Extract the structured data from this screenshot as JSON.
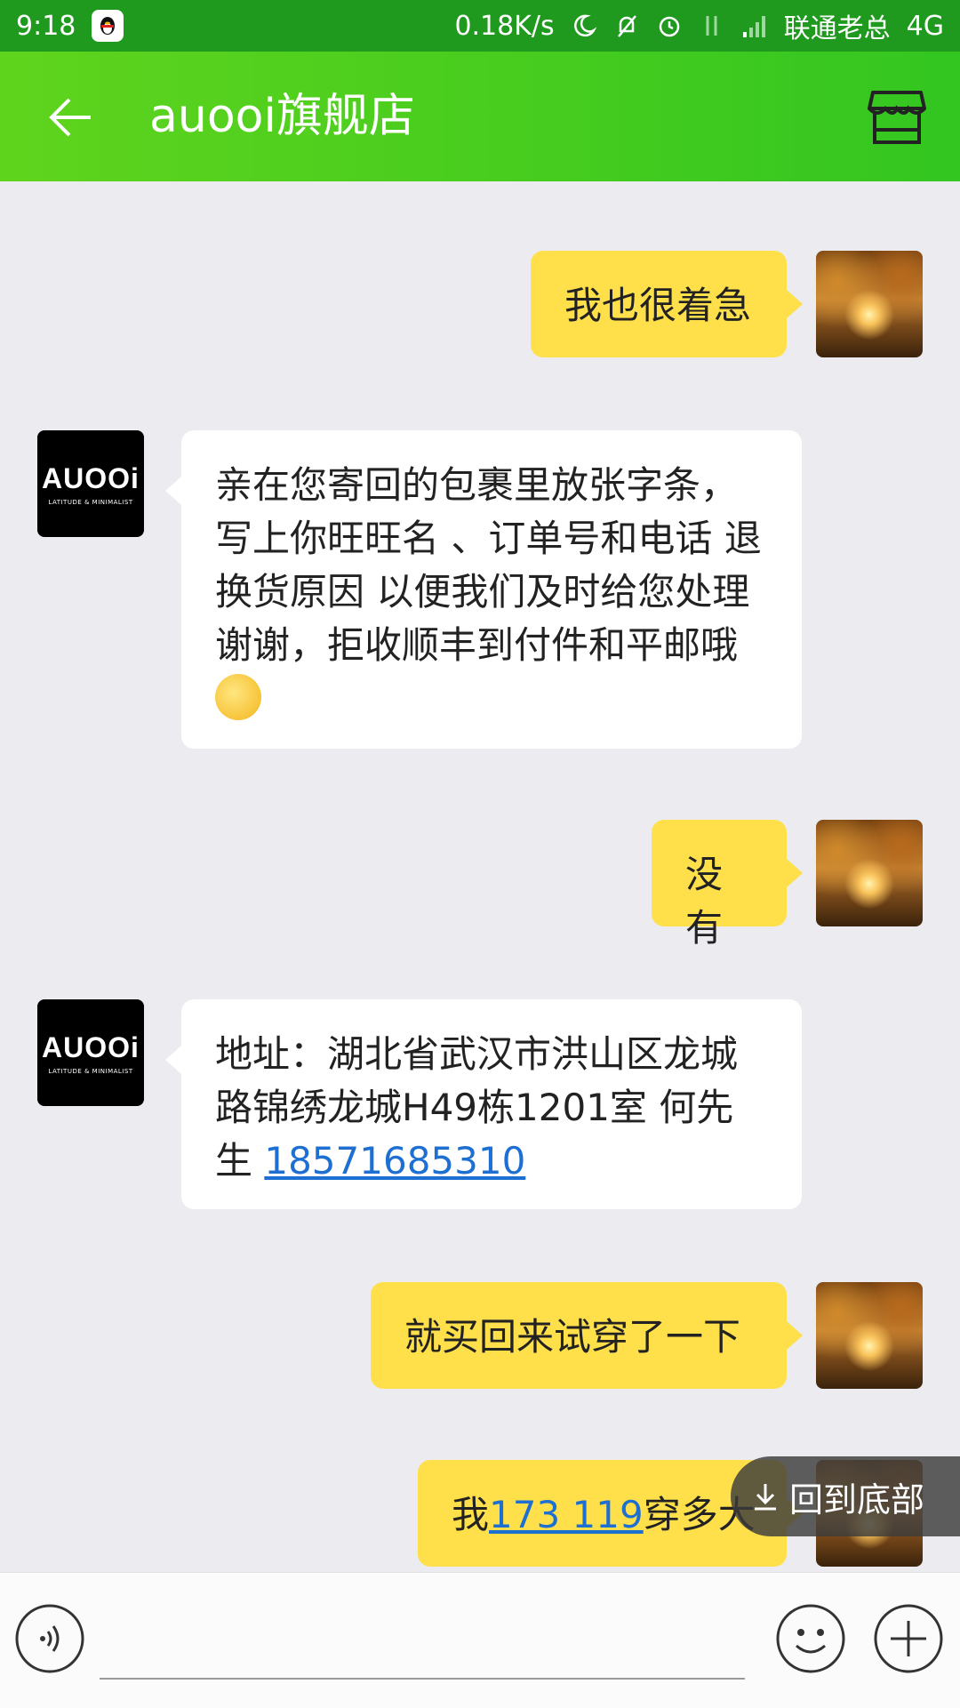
{
  "status_bar": {
    "time": "9:18",
    "network_speed": "0.18K/s",
    "carrier": "联通老总",
    "network_type": "4G"
  },
  "header": {
    "title": "auooi旗舰店"
  },
  "shop_avatar": {
    "brand": "AUOOi",
    "tagline": "LATITUDE & MINIMALIST"
  },
  "messages": [
    {
      "side": "out",
      "text": "我也很着急"
    },
    {
      "side": "in",
      "text": "亲在您寄回的包裹里放张字条，写上你旺旺名 、订单号和电话 退换货原因 以便我们及时给您处理  谢谢，拒收顺丰到付件和平邮哦"
    },
    {
      "side": "out",
      "text": "没有"
    },
    {
      "side": "in",
      "text_before": "地址：湖北省武汉市洪山区龙城路锦绣龙城H49栋1201室  何先生 ",
      "phone": "18571685310"
    },
    {
      "side": "out",
      "text": "就买回来试穿了一下"
    },
    {
      "side": "out",
      "text_before": "我",
      "link": "173   119",
      "text_after": "穿多大"
    }
  ],
  "back_to_bottom": "回到底部",
  "input": {
    "value": "",
    "placeholder": ""
  },
  "colors": {
    "header_green": "#33c620",
    "statusbar_green": "#1f9a1f",
    "outgoing_bubble": "#ffe04a",
    "incoming_bubble": "#ffffff",
    "link": "#1e6fd2"
  }
}
